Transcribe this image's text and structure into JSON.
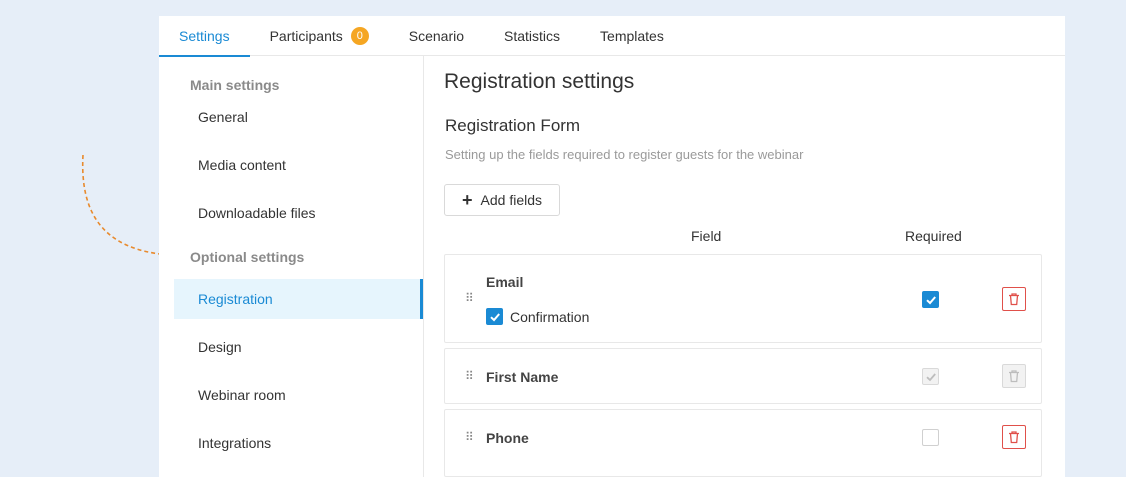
{
  "tabs": [
    {
      "label": "Settings",
      "active": true
    },
    {
      "label": "Participants",
      "badge": "0"
    },
    {
      "label": "Scenario"
    },
    {
      "label": "Statistics"
    },
    {
      "label": "Templates"
    }
  ],
  "sidebar": {
    "main_heading": "Main settings",
    "main_items": [
      "General",
      "Media content",
      "Downloadable files"
    ],
    "optional_heading": "Optional settings",
    "optional_items": [
      "Registration",
      "Design",
      "Webinar room",
      "Integrations"
    ],
    "active_item": "Registration"
  },
  "content": {
    "title": "Registration settings",
    "form_title": "Registration Form",
    "description": "Setting up the fields required to register guests for the webinar",
    "add_button": "Add fields",
    "col_field": "Field",
    "col_required": "Required",
    "rows": [
      {
        "name": "Email",
        "required": "checked",
        "deletable": true,
        "sub_label": "Confirmation",
        "sub_checked": true
      },
      {
        "name": "First Name",
        "required": "disabled-checked",
        "deletable": false
      },
      {
        "name": "Phone",
        "required": "unchecked",
        "deletable": true
      }
    ]
  },
  "colors": {
    "accent": "#1a8ad4",
    "badge": "#f5a623",
    "delete": "#e0504a",
    "annotation": "#e88a2d"
  },
  "icons": {
    "drag": "drag-handle-icon",
    "delete": "trash-icon",
    "check": "check-icon",
    "plus": "plus-icon"
  }
}
